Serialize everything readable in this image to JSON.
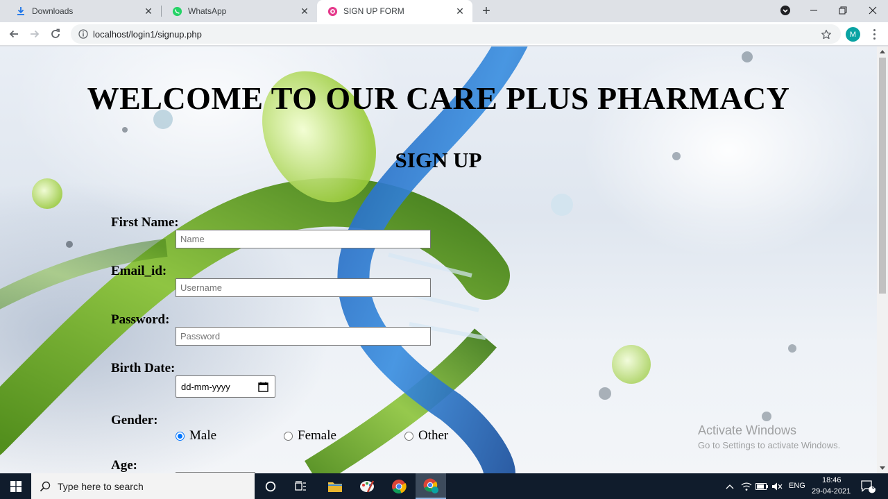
{
  "browser": {
    "tabs": [
      {
        "title": "Downloads",
        "icon": "download-icon"
      },
      {
        "title": "WhatsApp",
        "icon": "whatsapp-icon"
      },
      {
        "title": "SIGN UP FORM",
        "icon": "site-favicon",
        "active": true
      }
    ],
    "url": "localhost/login1/signup.php",
    "profile_initial": "M"
  },
  "page": {
    "title": "WELCOME TO OUR CARE PLUS PHARMACY",
    "subtitle": "SIGN UP",
    "fields": {
      "first_name_label": "First Name:",
      "first_name_placeholder": "Name",
      "email_label": "Email_id:",
      "email_placeholder": "Username",
      "password_label": "Password:",
      "password_placeholder": "Password",
      "birth_date_label": "Birth Date:",
      "birth_date_value": "dd-mm-yyyy",
      "gender_label": "Gender:",
      "gender_options": [
        "Male",
        "Female",
        "Other"
      ],
      "gender_selected": "Male",
      "age_label": "Age:"
    },
    "watermark": {
      "line1": "Activate Windows",
      "line2": "Go to Settings to activate Windows."
    }
  },
  "taskbar": {
    "search_placeholder": "Type here to search",
    "language": "ENG",
    "time": "18:46",
    "date": "29-04-2021",
    "notification_count": "9"
  },
  "colors": {
    "accent_radio": "#0075ff",
    "taskbar_bg": "#101c2c",
    "profile_bg": "#0aa3a3"
  }
}
